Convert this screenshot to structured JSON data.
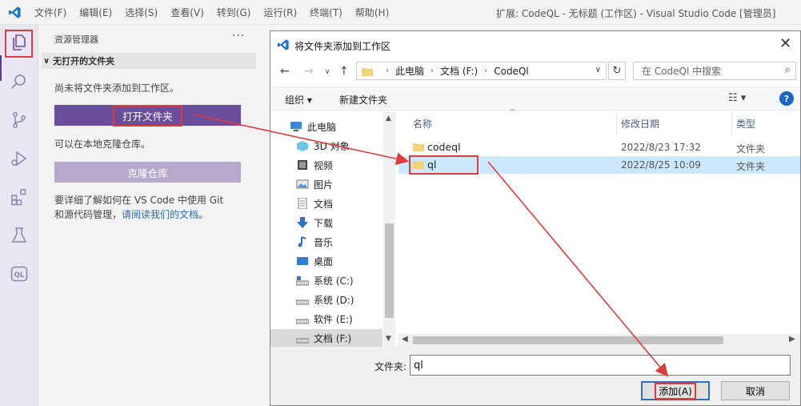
{
  "app": {
    "menu": [
      "文件(F)",
      "编辑(E)",
      "选择(S)",
      "查看(V)",
      "转到(G)",
      "运行(R)",
      "终端(T)",
      "帮助(H)"
    ],
    "window_title": "扩展: CodeQL - 无标题 (工作区) - Visual Studio Code [管理员]"
  },
  "activity_bar": {
    "icons": [
      "explorer-icon",
      "search-icon",
      "source-control-icon",
      "run-debug-icon",
      "extensions-icon",
      "testing-icon",
      "codeql-icon"
    ],
    "codeql_label": "QL"
  },
  "explorer": {
    "header": "资源管理器",
    "more": "···",
    "section": "无打开的文件夹",
    "no_folder_text": "尚未将文件夹添加到工作区。",
    "open_folder_button": "打开文件夹",
    "clone_text": "可以在本地克隆仓库。",
    "clone_button": "克隆仓库",
    "learn_text_1": "要详细了解如何在 VS Code 中使用 Git",
    "learn_text_2": "和源代码管理，",
    "learn_link": "请阅读我们的文档",
    "learn_text_end": "。"
  },
  "dialog": {
    "title": "将文件夹添加到工作区",
    "breadcrumb": [
      "此电脑",
      "文档 (F:)",
      "CodeQl"
    ],
    "search_placeholder": "在 CodeQl 中搜索",
    "toolbar": {
      "organize": "组织 ▾",
      "new_folder": "新建文件夹",
      "help": "?"
    },
    "nav_items": [
      {
        "label": "此电脑",
        "icon": "computer-icon",
        "selected": false
      },
      {
        "label": "3D 对象",
        "icon": "cube-icon",
        "selected": false
      },
      {
        "label": "视频",
        "icon": "video-icon",
        "selected": false
      },
      {
        "label": "图片",
        "icon": "picture-icon",
        "selected": false
      },
      {
        "label": "文档",
        "icon": "document-icon",
        "selected": false
      },
      {
        "label": "下载",
        "icon": "download-icon",
        "selected": false
      },
      {
        "label": "音乐",
        "icon": "music-icon",
        "selected": false
      },
      {
        "label": "桌面",
        "icon": "desktop-icon",
        "selected": false
      },
      {
        "label": "系统 (C:)",
        "icon": "drive-icon",
        "selected": false
      },
      {
        "label": "系统 (D:)",
        "icon": "drive-icon",
        "selected": false
      },
      {
        "label": "软件 (E:)",
        "icon": "drive-icon",
        "selected": false
      },
      {
        "label": "文档 (F:)",
        "icon": "drive-icon",
        "selected": true
      }
    ],
    "columns": {
      "name": "名称",
      "date": "修改日期",
      "type": "类型"
    },
    "files": [
      {
        "name": "codeql",
        "date": "2022/8/23 17:32",
        "type": "文件夹",
        "selected": false
      },
      {
        "name": "ql",
        "date": "2022/8/25 10:09",
        "type": "文件夹",
        "selected": true
      }
    ],
    "folder_label": "文件夹:",
    "folder_value": "ql",
    "add_button": "添加(A)",
    "cancel_button": "取消"
  },
  "colors": {
    "accent": "#6b4e9b",
    "annotation": "#e03b3b",
    "selection": "#cce8ff"
  }
}
